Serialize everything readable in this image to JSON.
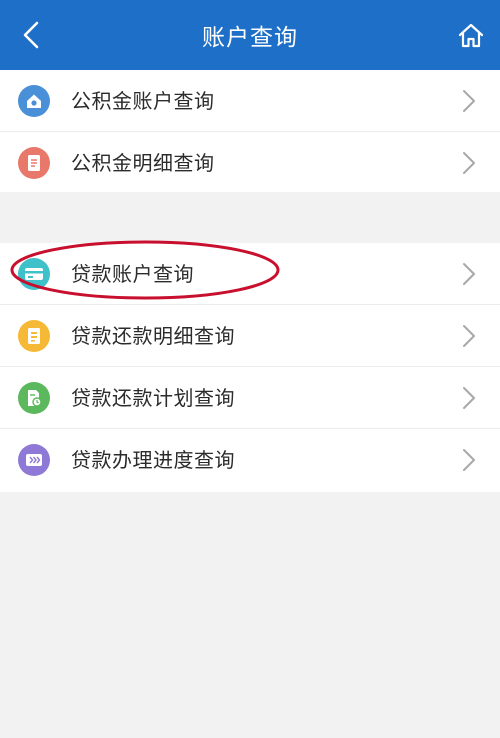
{
  "header": {
    "title": "账户查询",
    "back_icon": "chevron-left-icon",
    "home_icon": "home-icon"
  },
  "groups": [
    {
      "items": [
        {
          "label": "公积金账户查询",
          "icon": "house-icon",
          "color": "#4a90d9"
        },
        {
          "label": "公积金明细查询",
          "icon": "document-icon",
          "color": "#e8786a"
        }
      ]
    },
    {
      "items": [
        {
          "label": "贷款账户查询",
          "icon": "card-icon",
          "color": "#3fc1c9",
          "highlighted": true
        },
        {
          "label": "贷款还款明细查询",
          "icon": "document-icon",
          "color": "#f5b935"
        },
        {
          "label": "贷款还款计划查询",
          "icon": "file-clock-icon",
          "color": "#5cb85c"
        },
        {
          "label": "贷款办理进度查询",
          "icon": "progress-icon",
          "color": "#8e7ad6"
        }
      ]
    }
  ],
  "colors": {
    "header": "#1e6fc7",
    "highlight_ellipse": "#c8102e"
  }
}
